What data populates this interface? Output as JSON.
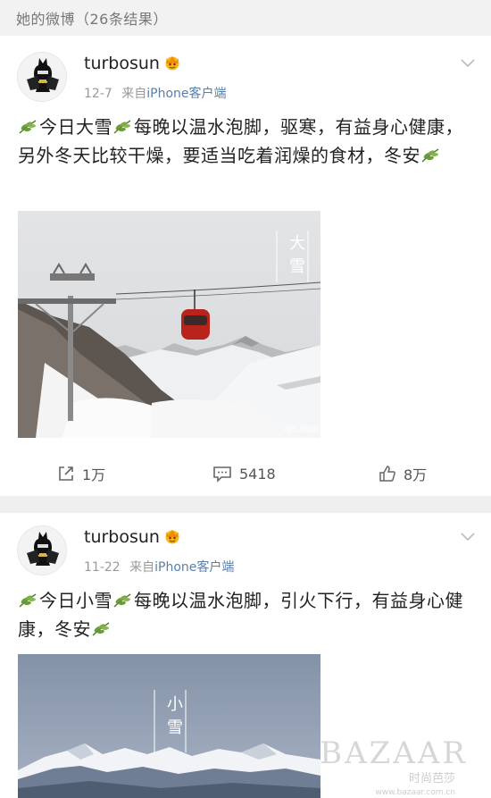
{
  "header": {
    "title": "她的微博（26条结果）"
  },
  "posts": [
    {
      "username": "turbosun",
      "date": "12-7",
      "source_prefix": "来自",
      "source_name": "iPhone客户端",
      "text_seg1": "今日大雪",
      "text_seg2": "每晚以温水泡脚，驱寒，有益身心健康，另外冬天比较干燥，要适当吃着润燥的食材，冬安",
      "photo_label": "大雪",
      "photo_watermark": "@turbo",
      "repost_count": "1万",
      "comment_count": "5418",
      "like_count": "8万"
    },
    {
      "username": "turbosun",
      "date": "11-22",
      "source_prefix": "来自",
      "source_name": "iPhone客户端",
      "text_seg1": "今日小雪",
      "text_seg2": "每晚以温水泡脚，引火下行，有益身心健康，冬安",
      "photo_label": "小雪"
    }
  ],
  "watermark": {
    "brand": "BAZAAR",
    "sub": "时尚芭莎",
    "url": "www.bazaar.com.cn"
  },
  "colors": {
    "link": "#5a7ea8",
    "leaf": "#6a9c3a",
    "background": "#efefef"
  },
  "icons": [
    "vip-crown-icon",
    "chevron-down-icon",
    "leaf-emoji-icon",
    "repost-icon",
    "comment-icon",
    "like-icon"
  ]
}
